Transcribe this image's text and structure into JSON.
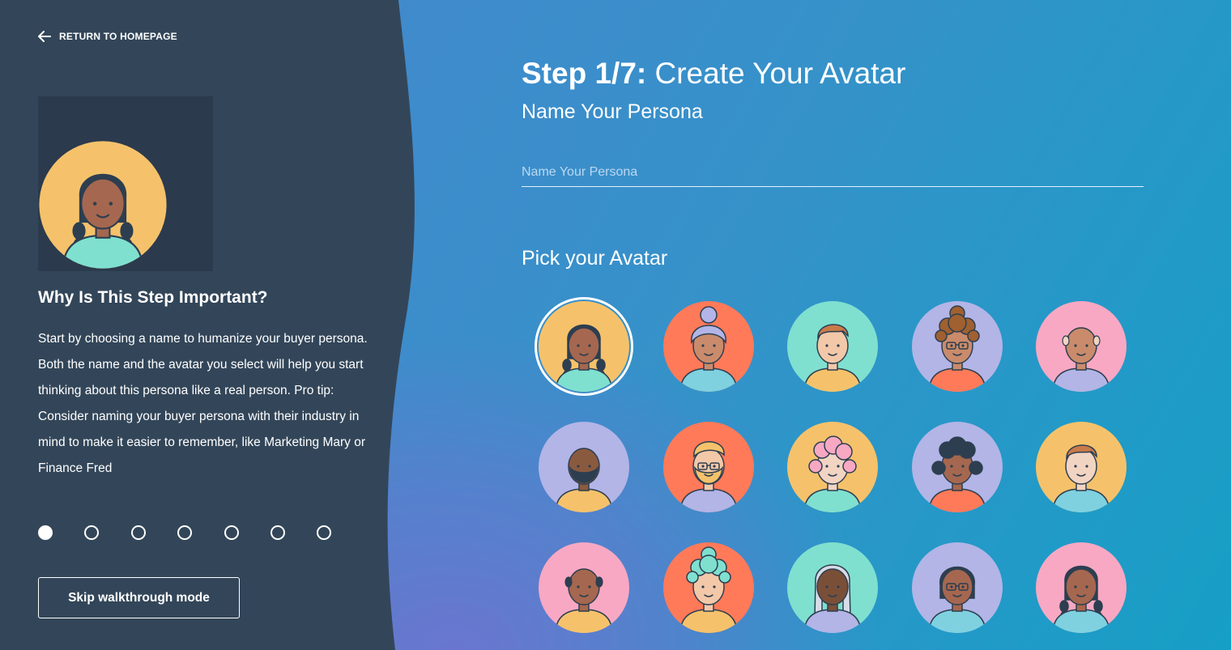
{
  "nav": {
    "return_label": "RETURN TO HOMEPAGE"
  },
  "sidebar": {
    "why_title": "Why Is This Step Important?",
    "why_text": "Start by choosing a name to humanize your buyer persona. Both the name and the avatar you select will help you start thinking about this persona like a real person. Pro tip: Consider naming your buyer persona with their industry in mind to make it easier to remember, like Marketing Mary or Finance Fred",
    "steps_total": 7,
    "step_active": 1,
    "skip_label": "Skip walkthrough mode"
  },
  "main": {
    "heading_step": "Step 1/7:",
    "heading_title": "Create Your Avatar",
    "subheading": "Name Your Persona",
    "name_input": {
      "value": "",
      "placeholder": "Name Your Persona"
    },
    "pick_label": "Pick your Avatar"
  },
  "colors": {
    "sidebar": "#334659",
    "preview_bg": "#2b3a4d",
    "yellow": "#f5c26b",
    "orange": "#ff7a59",
    "teal": "#7fe0d0",
    "lavender": "#b2b5e6",
    "pink": "#f8a8c3",
    "outline": "#2d3e50"
  },
  "avatars": [
    {
      "bg": "#f5c26b",
      "skin": "#a5674f",
      "hair": "#2d3e50",
      "shirt": "#7fe0d0",
      "style": "braids",
      "selected": true
    },
    {
      "bg": "#ff7a59",
      "skin": "#c98b6b",
      "hair": "#b2b5e6",
      "shirt": "#7fd1e0",
      "style": "bun",
      "selected": false
    },
    {
      "bg": "#7fe0d0",
      "skin": "#f2c8a8",
      "hair": "#c87a4a",
      "shirt": "#f5c26b",
      "style": "short",
      "selected": false
    },
    {
      "bg": "#b2b5e6",
      "skin": "#c98b6b",
      "hair": "#a0602f",
      "shirt": "#ff7a59",
      "style": "curly",
      "glasses": true,
      "selected": false
    },
    {
      "bg": "#f8a8c3",
      "skin": "#c98b6b",
      "hair": "#f2d4c3",
      "shirt": "#b2b5e6",
      "style": "bald",
      "selected": false
    },
    {
      "bg": "#b2b5e6",
      "skin": "#8a5a3f",
      "hair": "#2d3e50",
      "shirt": "#f5c26b",
      "style": "beard",
      "selected": false
    },
    {
      "bg": "#ff7a59",
      "skin": "#f2c8a8",
      "hair": "#f5c26b",
      "shirt": "#b2b5e6",
      "style": "beardblond",
      "glasses": true,
      "selected": false
    },
    {
      "bg": "#f5c26b",
      "skin": "#f2d4c3",
      "hair": "#f8a8c3",
      "shirt": "#7fe0d0",
      "style": "fluffy",
      "selected": false
    },
    {
      "bg": "#b2b5e6",
      "skin": "#a5674f",
      "hair": "#2d3e50",
      "shirt": "#ff7a59",
      "style": "curlydark",
      "selected": false
    },
    {
      "bg": "#f5c26b",
      "skin": "#f2d4c3",
      "hair": "#c87a4a",
      "shirt": "#7fd1e0",
      "style": "short",
      "selected": false
    },
    {
      "bg": "#f8a8c3",
      "skin": "#a5674f",
      "hair": "#2d3e50",
      "shirt": "#f5c26b",
      "style": "bald",
      "selected": false
    },
    {
      "bg": "#ff7a59",
      "skin": "#f2c8a8",
      "hair": "#7fe0d0",
      "shirt": "#f5c26b",
      "style": "curly",
      "selected": false
    },
    {
      "bg": "#7fe0d0",
      "skin": "#7a4f38",
      "hair": "#d8dbe8",
      "shirt": "#b2b5e6",
      "style": "long",
      "selected": false
    },
    {
      "bg": "#b2b5e6",
      "skin": "#a5674f",
      "hair": "#2d3e50",
      "shirt": "#7fd1e0",
      "style": "bob",
      "glasses": true,
      "selected": false
    },
    {
      "bg": "#f8a8c3",
      "skin": "#a5674f",
      "hair": "#2d3e50",
      "shirt": "#7fd1e0",
      "style": "braids",
      "selected": false
    }
  ]
}
